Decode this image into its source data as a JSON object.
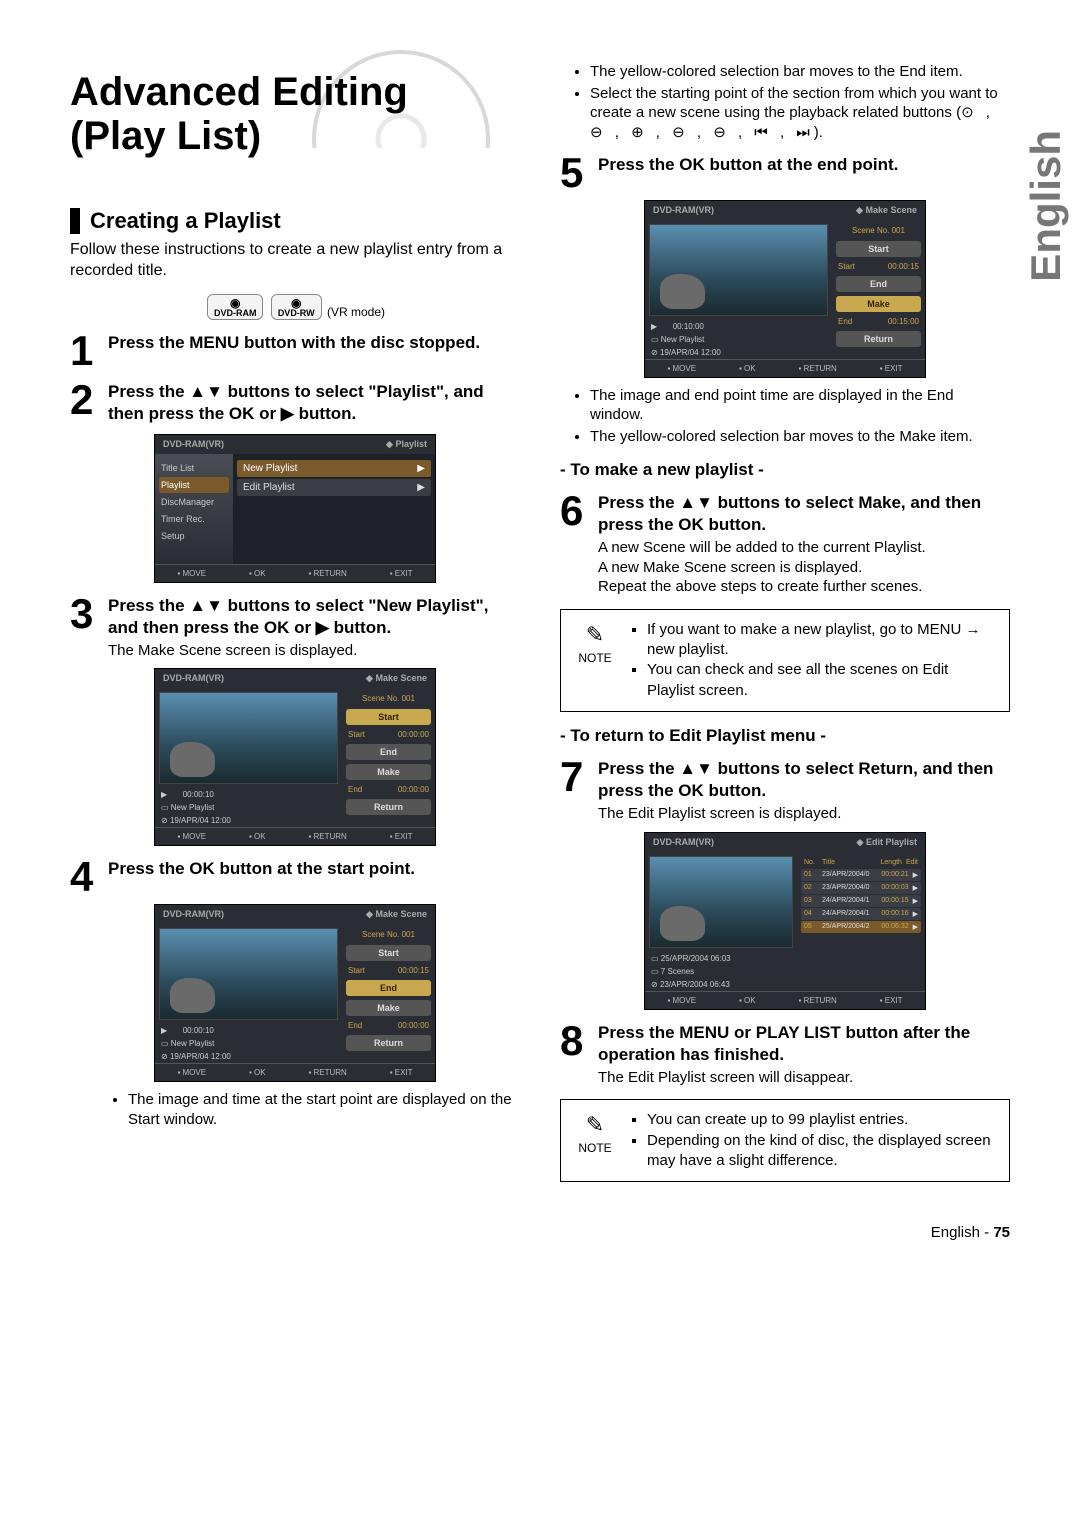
{
  "side_tab": "English",
  "title": {
    "line1": "Advanced Editing",
    "line2": "(Play List)"
  },
  "section1": {
    "heading": "Creating a Playlist",
    "intro": "Follow these instructions to create a new playlist entry from a recorded title.",
    "disc_label1": "DVD-RAM",
    "disc_label2": "DVD-RW",
    "vr_mode": "(VR mode)"
  },
  "steps": {
    "s1": {
      "num": "1",
      "title": "Press the MENU button with the disc stopped."
    },
    "s2": {
      "num": "2",
      "title": "Press the ▲▼ buttons to select \"Playlist\", and then press the OK or ▶ button."
    },
    "s3": {
      "num": "3",
      "title": "Press the ▲▼ buttons to select \"New Playlist\", and then press the OK or ▶ button.",
      "desc": "The Make Scene screen is displayed."
    },
    "s4": {
      "num": "4",
      "title": "Press the OK button at the start point."
    },
    "s4_b1": "The image and time at the start point are displayed on the Start window.",
    "s4_b2": "The yellow-colored selection bar moves to the End item.",
    "s4_b3_a": "Select the starting point of the section from which you want to create a new scene using the playback related buttons (",
    "s4_b3_glyphs": "⊙ , ⊖ , ⊕ , ⊖ , ⊖ , ⏮ , ⏭",
    "s4_b3_b": ").",
    "s5": {
      "num": "5",
      "title": "Press the OK button at the end point."
    },
    "s5_b1": "The image and end point time are displayed in the End window.",
    "s5_b2": "The yellow-colored selection bar moves to the Make item.",
    "sub_make": "- To make a new playlist -",
    "s6": {
      "num": "6",
      "title": "Press the ▲▼ buttons to select Make, and then press the OK button.",
      "desc1": "A new Scene will be added to the current Playlist.",
      "desc2": "A new Make Scene screen is displayed.",
      "desc3": "Repeat the above steps to create further scenes."
    },
    "note1_a": "If you want to make a new playlist, go to MENU → new playlist.",
    "note1_b": "You can check and see all the scenes on Edit Playlist screen.",
    "sub_return": "- To return to Edit Playlist menu -",
    "s7": {
      "num": "7",
      "title": "Press the ▲▼ buttons to select Return, and then press the OK button.",
      "desc": "The Edit Playlist screen is displayed."
    },
    "s8": {
      "num": "8",
      "title": "Press the MENU or PLAY LIST button after the operation has finished.",
      "desc": "The Edit Playlist screen will disappear."
    },
    "note2_a": "You can create up to 99 playlist entries.",
    "note2_b": "Depending on the kind of disc, the displayed screen may have a slight difference."
  },
  "note_label": "NOTE",
  "osd": {
    "device": "DVD-RAM(VR)",
    "mode_playlist": "◆ Playlist",
    "mode_makescene": "◆ Make Scene",
    "mode_editpl": "◆ Edit Playlist",
    "side_items": [
      "Title List",
      "Playlist",
      "DiscManager",
      "Timer Rec.",
      "Setup"
    ],
    "menu_new": "New Playlist",
    "menu_edit": "Edit Playlist",
    "footer": [
      "MOVE",
      "OK",
      "RETURN",
      "EXIT"
    ],
    "scene_no": "Scene No. 001",
    "btn_start": "Start",
    "btn_end": "End",
    "btn_make": "Make",
    "btn_return": "Return",
    "start_t0": "00:00:00",
    "start_t1": "00:00:15",
    "end_t0": "00:00:00",
    "end_t1": "00:15:00",
    "progress": "00:10:00",
    "time_bar": "00:00:10",
    "info_new": "New Playlist",
    "info_date": "19/APR/04 12:00",
    "ep_date1": "25/APR/2004 06:03",
    "ep_scenes": "7 Scenes",
    "ep_date2": "23/APR/2004 06:43",
    "ep_cols": {
      "no": "No.",
      "title": "Title",
      "length": "Length",
      "edit": "Edit"
    },
    "ep_rows": [
      {
        "n": "01",
        "t": "23/APR/2004/0",
        "l": "00:00:21"
      },
      {
        "n": "02",
        "t": "23/APR/2004/0",
        "l": "00:00:03"
      },
      {
        "n": "03",
        "t": "24/APR/2004/1",
        "l": "00:00:15"
      },
      {
        "n": "04",
        "t": "24/APR/2004/1",
        "l": "00:00:16"
      },
      {
        "n": "05",
        "t": "25/APR/2004/2",
        "l": "00:06:32"
      }
    ]
  },
  "footer": {
    "lang": "English",
    "sep": " - ",
    "page": "75"
  }
}
